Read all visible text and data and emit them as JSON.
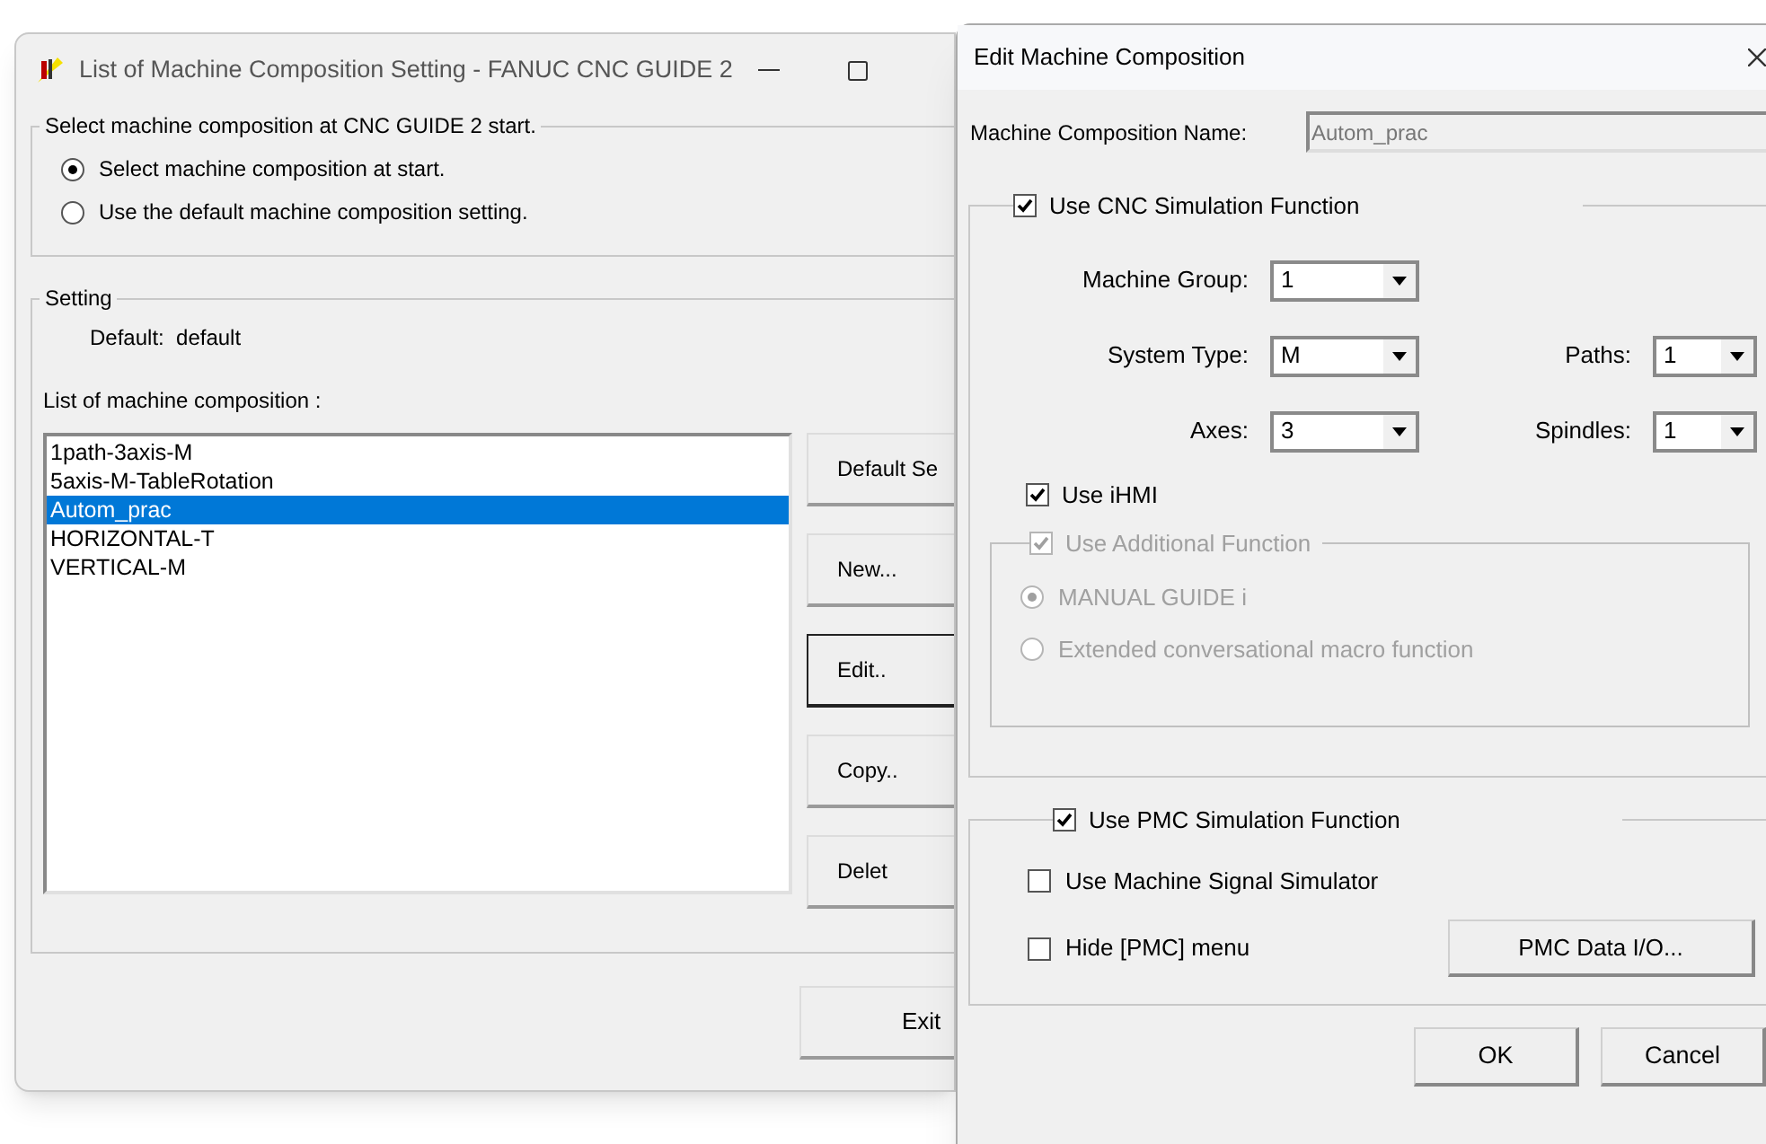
{
  "main_window": {
    "title": "List of Machine Composition Setting - FANUC CNC GUIDE 2",
    "startup_group": {
      "legend": "Select machine composition at CNC GUIDE 2 start.",
      "options": [
        {
          "label": "Select machine composition at start.",
          "selected": true
        },
        {
          "label": "Use the default machine composition setting.",
          "selected": false
        }
      ]
    },
    "setting_group": {
      "legend": "Setting",
      "default_text": "Default:  default",
      "list_label": "List of machine composition :",
      "items": [
        {
          "label": "1path-3axis-M",
          "selected": false
        },
        {
          "label": "5axis-M-TableRotation",
          "selected": false
        },
        {
          "label": "Autom_prac",
          "selected": true
        },
        {
          "label": "HORIZONTAL-T",
          "selected": false
        },
        {
          "label": "VERTICAL-M",
          "selected": false
        }
      ],
      "buttons": [
        {
          "label": "Default Se",
          "focused": false
        },
        {
          "label": "New...",
          "focused": false
        },
        {
          "label": "Edit..",
          "focused": true
        },
        {
          "label": "Copy..",
          "focused": false
        },
        {
          "label": "Delet",
          "focused": false
        }
      ]
    },
    "exit_button": "Exit"
  },
  "dialog": {
    "title": "Edit Machine Composition",
    "name_label": "Machine Composition Name:",
    "name_value": "Autom_prac",
    "cnc_group": {
      "label": "Use CNC Simulation Function",
      "checked": true,
      "rows": [
        [
          {
            "label": "Machine Group:",
            "value": "1"
          }
        ],
        [
          {
            "label": "System Type:",
            "value": "M"
          },
          {
            "label": "Paths:",
            "value": "1"
          }
        ],
        [
          {
            "label": "Axes:",
            "value": "3"
          },
          {
            "label": "Spindles:",
            "value": "1"
          }
        ]
      ],
      "ihmi": {
        "label": "Use iHMI",
        "checked": true
      },
      "additional": {
        "label": "Use Additional Function",
        "checked": true,
        "disabled": true,
        "options": [
          {
            "label": "MANUAL GUIDE i",
            "selected": true
          },
          {
            "label": "Extended conversational macro function",
            "selected": false
          }
        ]
      }
    },
    "pmc_group": {
      "label": "Use PMC Simulation Function",
      "checked": true,
      "options": [
        {
          "label": "Use Machine Signal Simulator",
          "checked": false
        },
        {
          "label": "Hide [PMC] menu",
          "checked": false
        }
      ],
      "data_button": "PMC Data I/O..."
    },
    "buttons": [
      "OK",
      "Cancel"
    ]
  }
}
